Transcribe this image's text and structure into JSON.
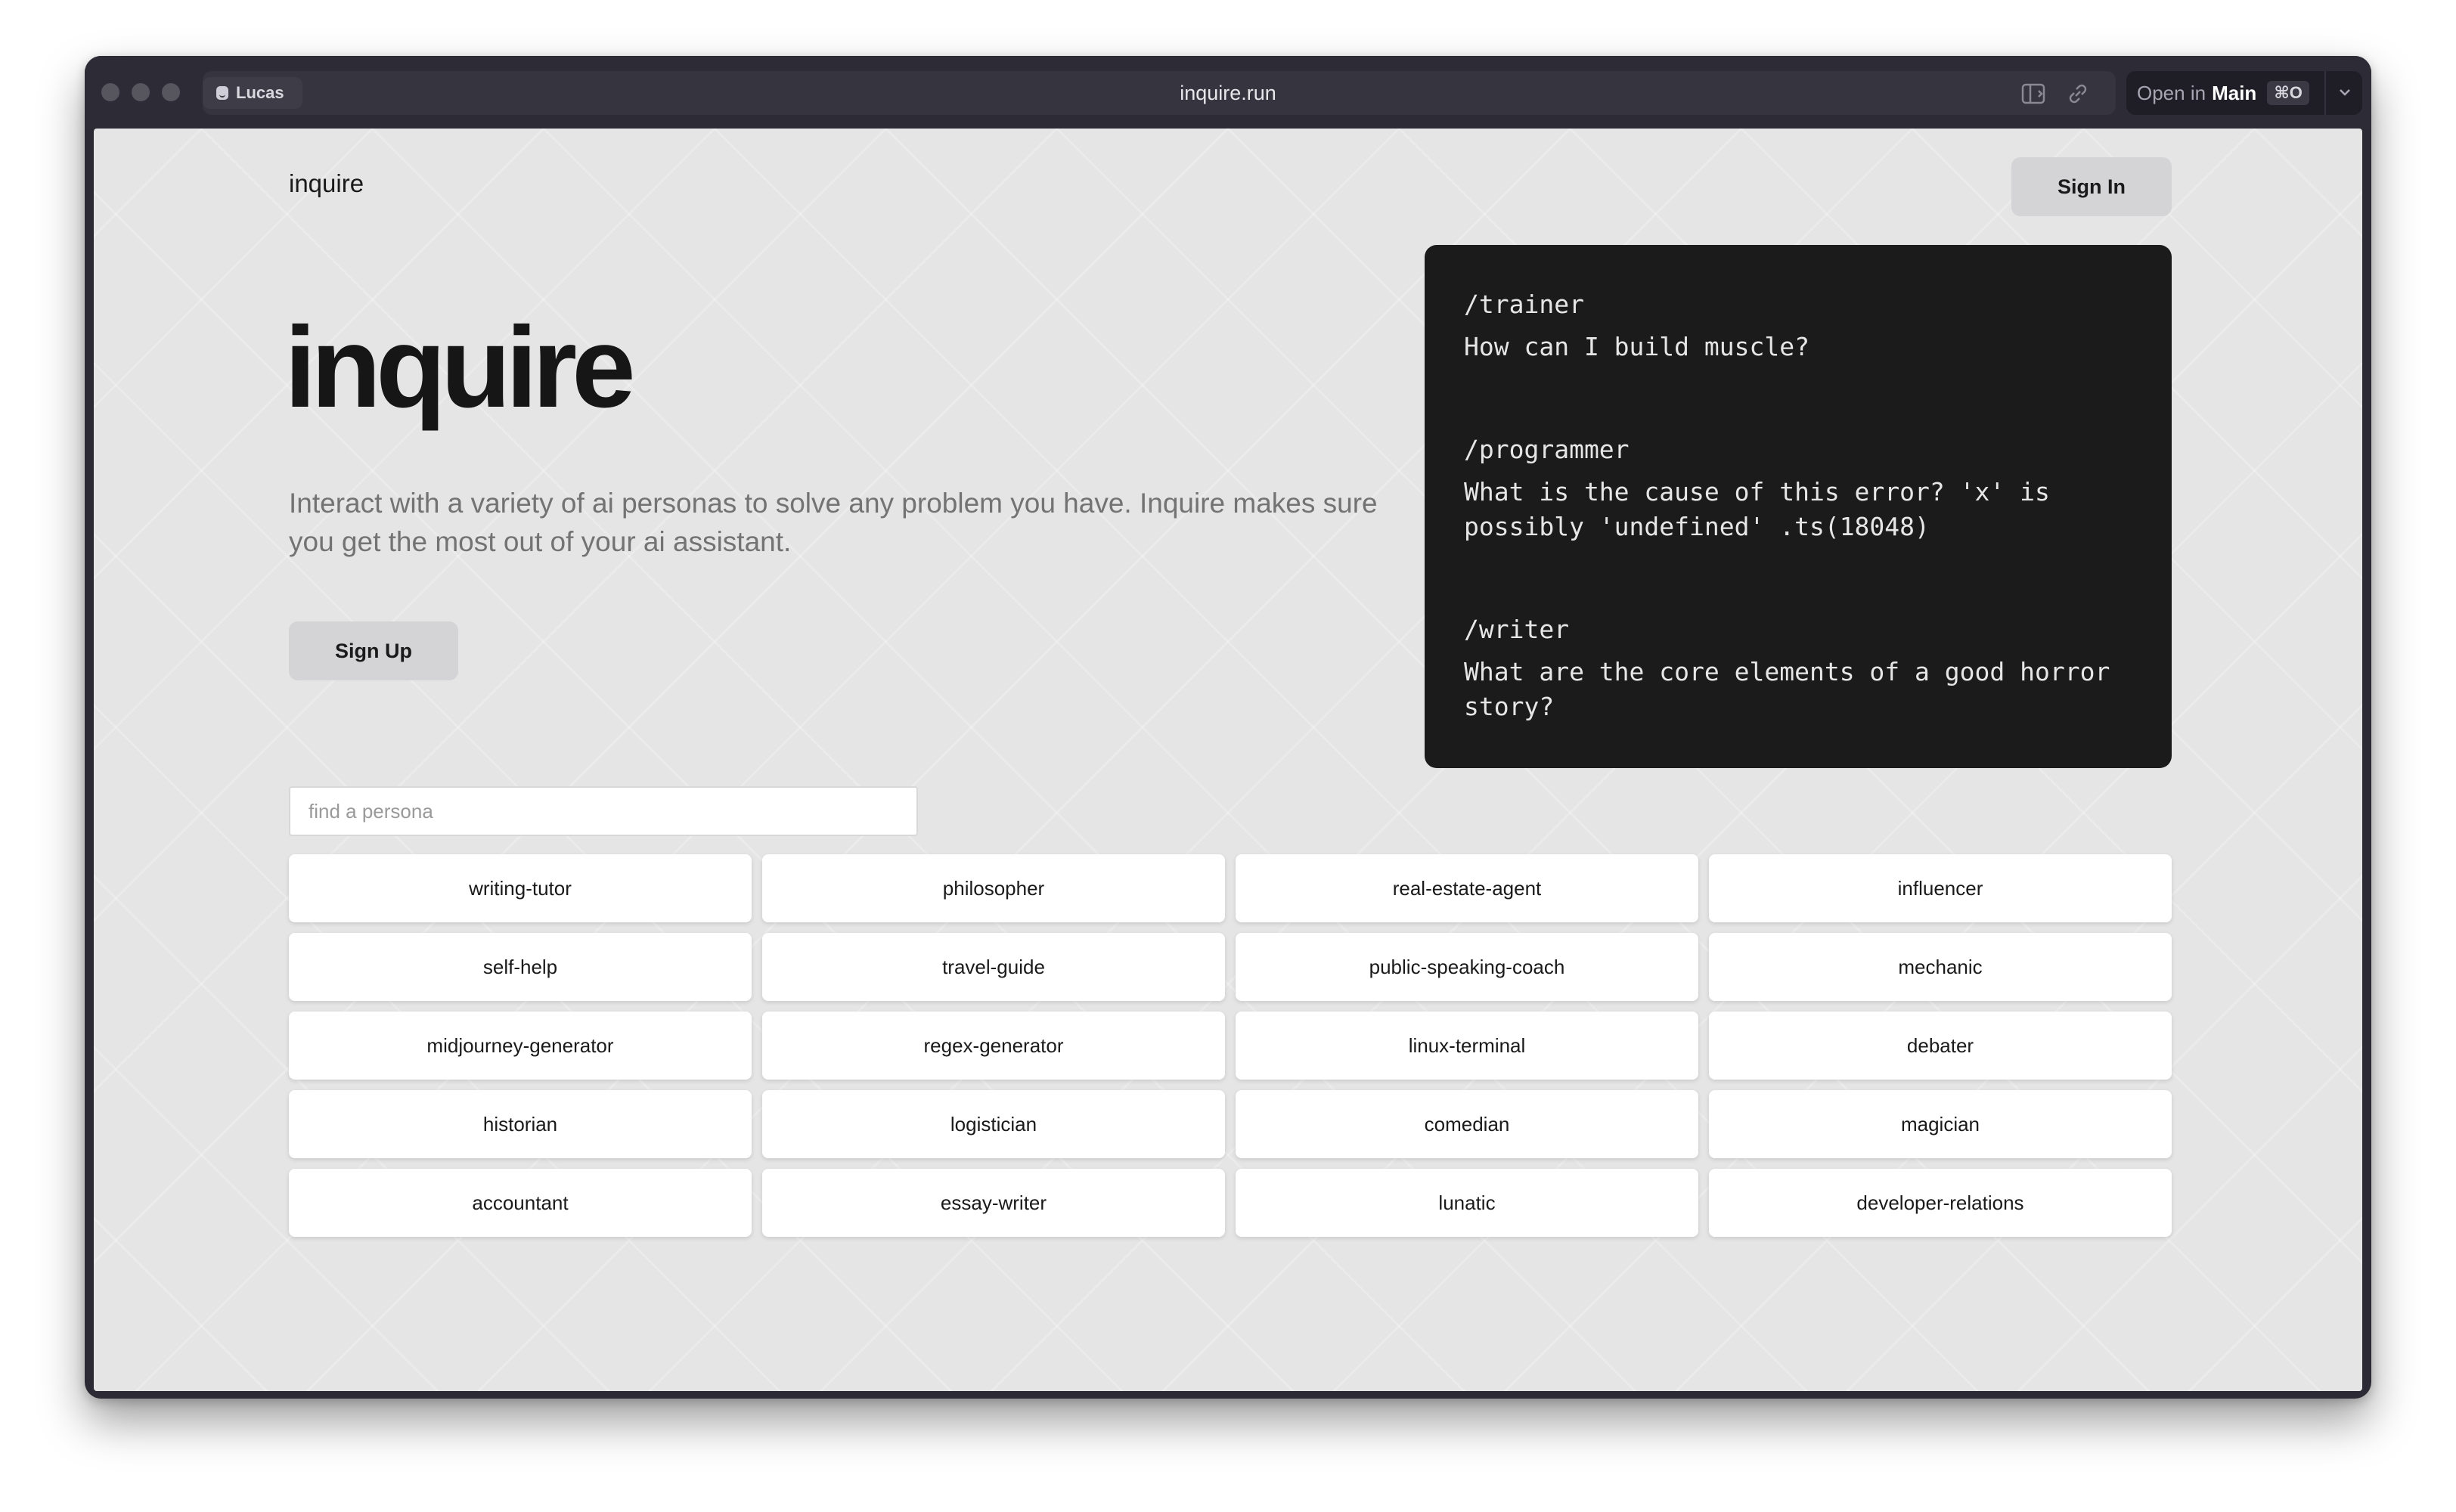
{
  "browser": {
    "profile_name": "Lucas",
    "url": "inquire.run",
    "open_in_prefix": "Open in",
    "open_in_target": "Main",
    "open_in_shortcut": "⌘O"
  },
  "nav": {
    "brand": "inquire",
    "signin_label": "Sign In"
  },
  "hero": {
    "title": "inquire",
    "description": "Interact with a variety of ai personas to solve any problem you have. Inquire makes sure you get the most out of your ai assistant.",
    "signup_label": "Sign Up"
  },
  "terminal": {
    "entries": [
      {
        "command": "/trainer",
        "question": "How can I build muscle?"
      },
      {
        "command": "/programmer",
        "question": "What is the cause of this error? 'x' is possibly 'undefined' .ts(18048)"
      },
      {
        "command": "/writer",
        "question": "What are the core elements of a good horror story?"
      }
    ]
  },
  "search": {
    "placeholder": "find a persona",
    "value": ""
  },
  "personas": [
    "writing-tutor",
    "philosopher",
    "real-estate-agent",
    "influencer",
    "self-help",
    "travel-guide",
    "public-speaking-coach",
    "mechanic",
    "midjourney-generator",
    "regex-generator",
    "linux-terminal",
    "debater",
    "historian",
    "logistician",
    "comedian",
    "magician",
    "accountant",
    "essay-writer",
    "lunatic",
    "developer-relations"
  ],
  "icons": {
    "profile": "smiley-icon",
    "sidebar": "sidebar-toggle-icon",
    "link": "link-icon",
    "dropdown": "chevron-down-icon"
  },
  "colors": {
    "titlebar": "#2d2b35",
    "page_background": "#e5e5e5",
    "terminal_background": "#1b1b1b",
    "button_background": "#d4d4d6"
  }
}
